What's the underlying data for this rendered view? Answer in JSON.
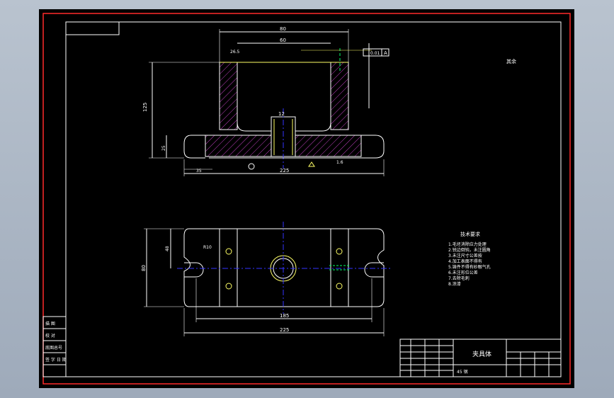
{
  "drawing": {
    "title": "夹具体",
    "roughness_note": "其余",
    "material": "45 钢",
    "requirements_title": "技术要求",
    "requirements": [
      "1.毛坯消除应力处理",
      "2.锐边倒钝，未注圆角",
      "3.未注尺寸公差按",
      "4.加工表面不得有",
      "5.铸件不得有砂眼气孔",
      "6.未注形位公差",
      "7.去除毛刺",
      "8.涂漆"
    ],
    "dims": {
      "top_width": "80",
      "inner_width": "60",
      "offset": "26.5",
      "height": "125",
      "base_height": "25",
      "hole": "12",
      "total_width": "225",
      "left_offset": "35",
      "plan_height": "80",
      "plan_inner": "48",
      "hole_spacing": "185",
      "plan_total": "225",
      "slot_radius": "R10"
    },
    "datum": {
      "ref": "A",
      "tol": "0.01"
    },
    "left_stamp_rows": [
      "描 图",
      "校 对",
      "底图总号",
      "签 字 日 期"
    ]
  },
  "colors": {
    "background": "#000000",
    "border": "#ff2a2a",
    "line": "#ffffff",
    "hatch": "#c040c0",
    "center": "#3333ff",
    "hole": "#ffff66",
    "accent": "#00ff66"
  }
}
